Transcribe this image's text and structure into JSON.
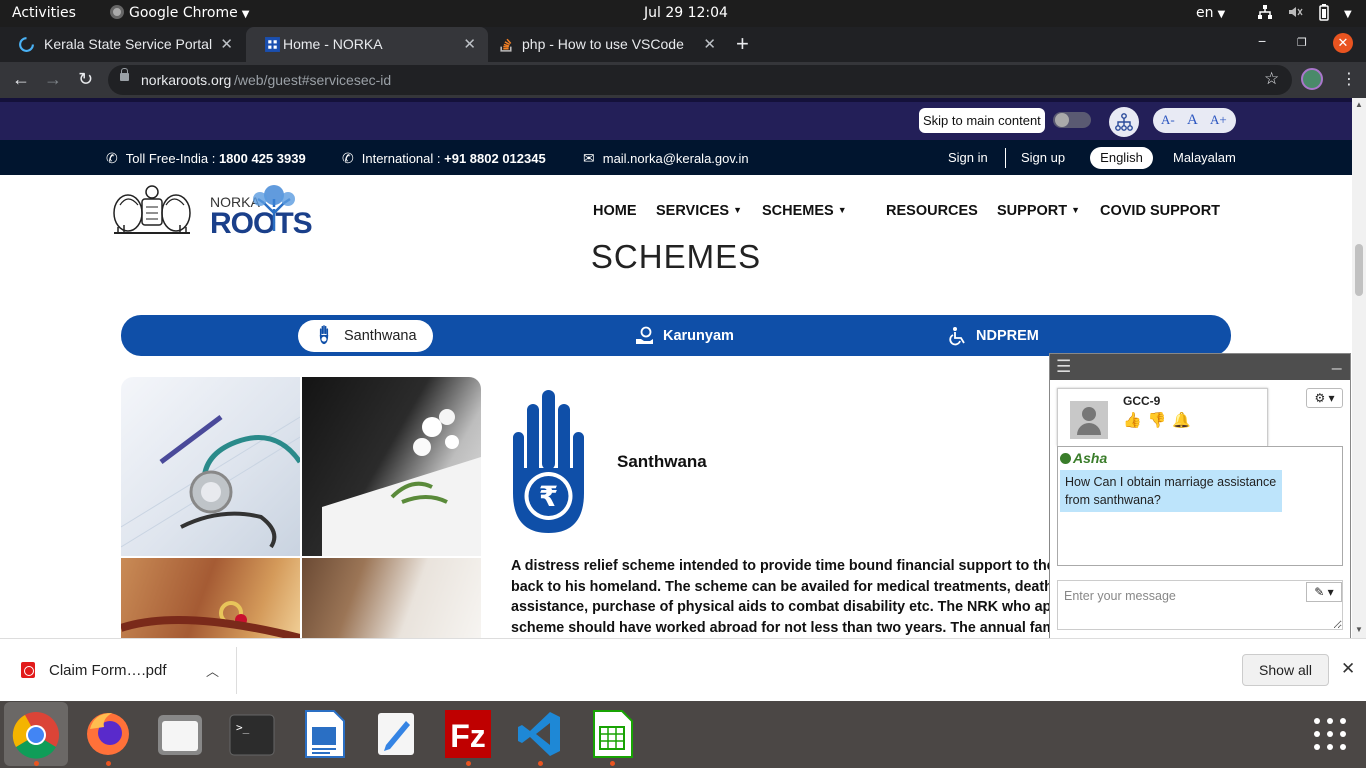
{
  "system": {
    "activities": "Activities",
    "app_menu": "Google Chrome",
    "clock": "Jul 29  12:04",
    "lang": "en"
  },
  "tabs": [
    {
      "title": "Kerala State Service Portal",
      "favicon": "loading-spinner-icon"
    },
    {
      "title": "Home - NORKA",
      "favicon": "norka-favicon-icon"
    },
    {
      "title": "php - How to use VSCode",
      "favicon": "stackoverflow-icon"
    }
  ],
  "omnibox": {
    "host": "norkaroots.org",
    "path": "/web/guest#servicesec-id"
  },
  "accessibility": {
    "skip_label": "Skip to main content",
    "font_small": "A-",
    "font_normal": "A",
    "font_large": "A+"
  },
  "contact": {
    "tollfree_label": "Toll Free-India : ",
    "tollfree_number": "1800 425 3939",
    "intl_label": "International : ",
    "intl_number": "+91 8802 012345",
    "email": "mail.norka@kerala.gov.in",
    "sign_in": "Sign in",
    "sign_up": "Sign up",
    "lang_english": "English",
    "lang_malayalam": "Malayalam"
  },
  "logo": {
    "line1": "NORKA",
    "line2": "ROOTS"
  },
  "nav": {
    "home": "HOME",
    "services": "SERVICES",
    "schemes": "SCHEMES",
    "resources": "RESOURCES",
    "support": "SUPPORT",
    "covid": "COVID SUPPORT"
  },
  "page": {
    "section_title": "SCHEMES",
    "scheme_tabs": [
      "Santhwana",
      "Karunyam",
      "NDPREM"
    ],
    "scheme_heading": "Santhwana",
    "description_lines": [
      "A distress relief scheme intended to provide time bound financial support to the NRK who returned",
      "back to his homeland. The scheme can be availed for medical treatments, death assistance, marriage",
      "assistance, purchase of physical aids to combat disability etc. The NRK who apply under this",
      "scheme should have worked abroad for not less than two years. The annual family income should"
    ]
  },
  "chat": {
    "agent_name": "GCC-9",
    "sender": "Asha",
    "message": "How Can I obtain marriage assistance from santhwana?",
    "input_placeholder": "Enter your message"
  },
  "downloads": {
    "file_name": "Claim Form….pdf",
    "show_all": "Show all"
  },
  "colors": {
    "access_bar": "#231f58",
    "contact_bar": "#01152f",
    "scheme_tabs": "#0f4fa8",
    "ubuntu_orange": "#e95420"
  }
}
